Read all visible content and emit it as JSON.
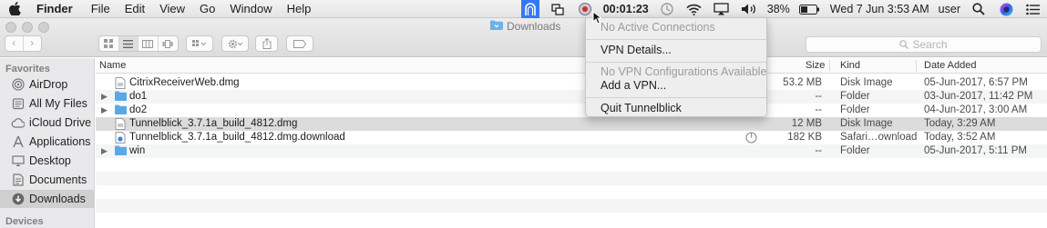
{
  "menubar": {
    "apple_icon": "apple-icon",
    "app_name": "Finder",
    "menus": [
      "File",
      "Edit",
      "View",
      "Go",
      "Window",
      "Help"
    ],
    "timer": "00:01:23",
    "battery": "38%",
    "datetime": "Wed 7 Jun  3:53 AM",
    "user": "user"
  },
  "window": {
    "title": "Downloads",
    "search_placeholder": "Search"
  },
  "sidebar": {
    "favorites_heading": "Favorites",
    "devices_heading": "Devices",
    "items": [
      {
        "label": "AirDrop",
        "icon": "airdrop-icon"
      },
      {
        "label": "All My Files",
        "icon": "all-files-icon"
      },
      {
        "label": "iCloud Drive",
        "icon": "cloud-icon"
      },
      {
        "label": "Applications",
        "icon": "applications-icon"
      },
      {
        "label": "Desktop",
        "icon": "desktop-icon"
      },
      {
        "label": "Documents",
        "icon": "documents-icon"
      },
      {
        "label": "Downloads",
        "icon": "downloads-icon"
      }
    ]
  },
  "columns": {
    "name": "Name",
    "size": "Size",
    "kind": "Kind",
    "date_added": "Date Added"
  },
  "files": [
    {
      "name": "CitrixReceiverWeb.dmg",
      "size": "53.2 MB",
      "kind": "Disk Image",
      "date": "05-Jun-2017, 6:57 PM"
    },
    {
      "name": "do1",
      "size": "--",
      "kind": "Folder",
      "date": "03-Jun-2017, 11:42 PM"
    },
    {
      "name": "do2",
      "size": "--",
      "kind": "Folder",
      "date": "04-Jun-2017, 3:00 AM"
    },
    {
      "name": "Tunnelblick_3.7.1a_build_4812.dmg",
      "size": "12 MB",
      "kind": "Disk Image",
      "date": "Today, 3:29 AM"
    },
    {
      "name": "Tunnelblick_3.7.1a_build_4812.dmg.download",
      "size": "182 KB",
      "kind": "Safari…ownload",
      "date": "Today, 3:52 AM"
    },
    {
      "name": "win",
      "size": "--",
      "kind": "Folder",
      "date": "05-Jun-2017, 5:11 PM"
    }
  ],
  "vpn_menu": {
    "no_active": "No Active Connections",
    "details": "VPN Details...",
    "no_configs": "No VPN Configurations Available",
    "add_vpn": "Add a VPN...",
    "quit": "Quit Tunnelblick"
  },
  "colors": {
    "accent": "#3478f6",
    "folder": "#5aa9e6",
    "selection": "#dcdcdc"
  }
}
